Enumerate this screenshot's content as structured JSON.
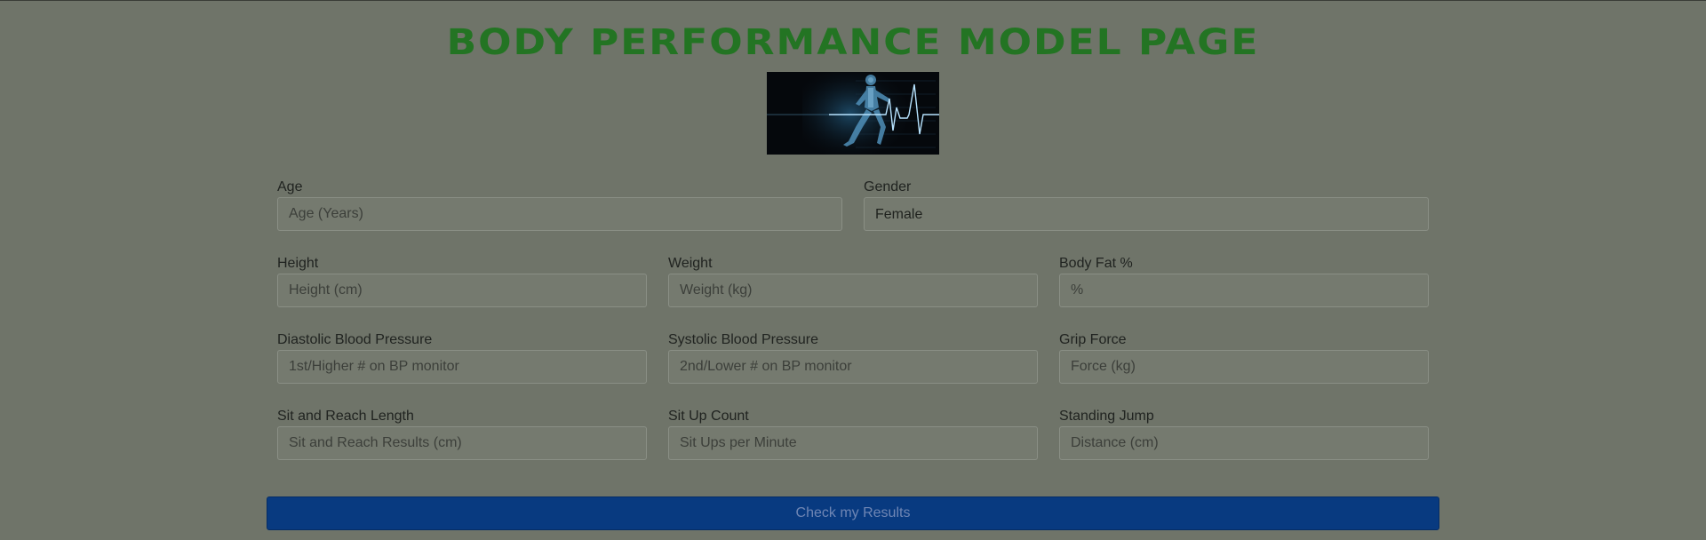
{
  "page": {
    "title": "BODY PERFORMANCE MODEL PAGE"
  },
  "hero_image": {
    "description_icon": "running-skeleton-heartbeat-image"
  },
  "colors": {
    "title": "#237423",
    "button": "#083a80",
    "background": "#6f7469"
  },
  "form": {
    "age": {
      "label": "Age",
      "placeholder": "Age (Years)",
      "value": ""
    },
    "gender": {
      "label": "Gender",
      "value": "Female"
    },
    "height": {
      "label": "Height",
      "placeholder": "Height (cm)",
      "value": ""
    },
    "weight": {
      "label": "Weight",
      "placeholder": "Weight (kg)",
      "value": ""
    },
    "body_fat": {
      "label": "Body Fat %",
      "placeholder": "%",
      "value": ""
    },
    "diastolic": {
      "label": "Diastolic Blood Pressure",
      "placeholder": "1st/Higher # on BP monitor",
      "value": ""
    },
    "systolic": {
      "label": "Systolic Blood Pressure",
      "placeholder": "2nd/Lower # on BP monitor",
      "value": ""
    },
    "grip_force": {
      "label": "Grip Force",
      "placeholder": "Force (kg)",
      "value": ""
    },
    "sit_reach": {
      "label": "Sit and Reach Length",
      "placeholder": "Sit and Reach Results (cm)",
      "value": ""
    },
    "sit_ups": {
      "label": "Sit Up Count",
      "placeholder": "Sit Ups per Minute",
      "value": ""
    },
    "standing_jump": {
      "label": "Standing Jump",
      "placeholder": "Distance (cm)",
      "value": ""
    },
    "submit_label": "Check my Results"
  }
}
